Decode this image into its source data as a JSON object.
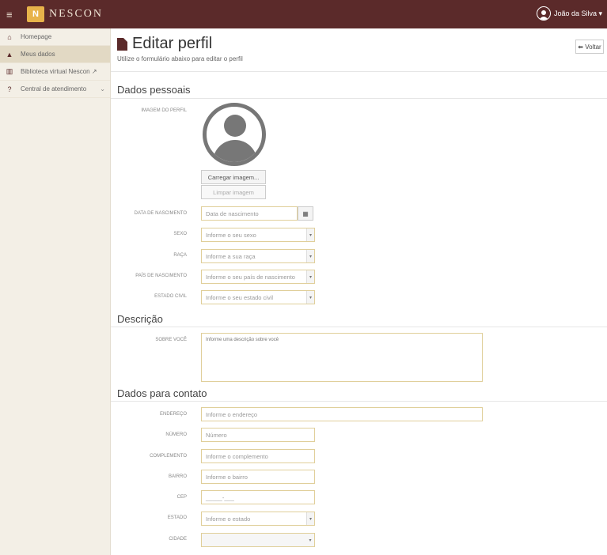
{
  "topbar": {
    "menu_glyph": "≡",
    "logo_glyph": "N",
    "brand": "NESCON",
    "user_name": "João da Silva ▾"
  },
  "sidebar": {
    "items": [
      {
        "icon": "home-icon",
        "glyph": "⌂",
        "label": "Homepage"
      },
      {
        "icon": "user-icon",
        "glyph": "▲",
        "label": "Meus dados"
      },
      {
        "icon": "library-icon",
        "glyph": "▥",
        "label": "Biblioteca virtual Nescon ↗"
      },
      {
        "icon": "help-icon",
        "glyph": "?",
        "label": "Central de atendimento",
        "chevron": "⌄"
      }
    ]
  },
  "header": {
    "title": "Editar perfil",
    "subtitle": "Utilize o formulário abaixo para editar o perfil",
    "back_label": "⬅ Voltar"
  },
  "personal": {
    "section_title": "Dados pessoais",
    "image_label": "Imagem do perfil",
    "upload_label": "Carregar imagem...",
    "clear_label": "Limpar imagem",
    "birth_label": "Data de nascimento",
    "birth_placeholder": "Data de nascimento",
    "calendar_glyph": "▦",
    "sex_label": "Sexo",
    "sex_placeholder": "Informe o seu sexo",
    "race_label": "Raça",
    "race_placeholder": "Informe a sua raça",
    "country_label": "País de nascimento",
    "country_placeholder": "Informe o seu país de nascimento",
    "civil_label": "Estado civil",
    "civil_placeholder": "Informe o seu estado civil"
  },
  "description": {
    "section_title": "Descrição",
    "about_label": "Sobre você",
    "about_placeholder": "Informe uma descrição sobre você"
  },
  "contact": {
    "section_title": "Dados para contato",
    "address_label": "Endereço",
    "address_placeholder": "Informe o endereço",
    "number_label": "Número",
    "number_placeholder": "Número",
    "complement_label": "Complemento",
    "complement_placeholder": "Informe o complemento",
    "district_label": "Bairro",
    "district_placeholder": "Informe o bairro",
    "cep_label": "CEP",
    "cep_placeholder": "_____-___",
    "state_label": "Estado",
    "state_placeholder": "Informe o estado",
    "city_label": "Cidade",
    "city_placeholder": ""
  },
  "select_arrow_glyph": "▾",
  "colors": {
    "topbar": "#5b2a2a",
    "sidebar": "#f3efe6",
    "field_border": "#e0cf9a",
    "logo": "#e8b34a"
  }
}
